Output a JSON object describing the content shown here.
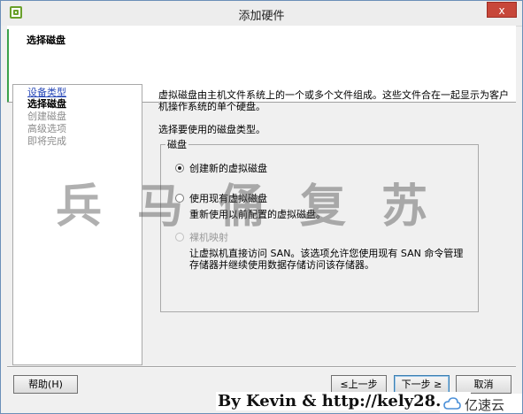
{
  "window": {
    "title": "添加硬件",
    "close_label": "x"
  },
  "header": {
    "title": "选择磁盘"
  },
  "nav": {
    "items": [
      {
        "label": "设备类型",
        "state": "link"
      },
      {
        "label": "选择磁盘",
        "state": "current"
      },
      {
        "label": "创建磁盘",
        "state": "disabled"
      },
      {
        "label": "高级选项",
        "state": "disabled"
      },
      {
        "label": "即将完成",
        "state": "disabled"
      }
    ]
  },
  "main": {
    "description": "虚拟磁盘由主机文件系统上的一个或多个文件组成。这些文件合在一起显示为客户机操作系统的单个硬盘。",
    "prompt": "选择要使用的磁盘类型。",
    "group_label": "磁盘",
    "options": [
      {
        "label": "创建新的虚拟磁盘",
        "checked": true,
        "enabled": true,
        "description": ""
      },
      {
        "label": "使用现有虚拟磁盘",
        "checked": false,
        "enabled": true,
        "description": "重新使用以前配置的虚拟磁盘。"
      },
      {
        "label": "裸机映射",
        "checked": false,
        "enabled": false,
        "description": "让虚拟机直接访问 SAN。该选项允许您使用现有 SAN 命令管理存储器并继续使用数据存储访问该存储器。"
      }
    ]
  },
  "buttons": {
    "help": "帮助(H)",
    "back": "≤上一步",
    "next": "下一步 ≥",
    "cancel": "取消"
  },
  "overlay": {
    "watermark": "兵马俑复苏",
    "credit": "By Kevin & http://kely28.blo",
    "brand": "亿速云"
  },
  "colors": {
    "accent": "#3aa14a",
    "link": "#2a4ab8",
    "close": "#c7473a"
  }
}
